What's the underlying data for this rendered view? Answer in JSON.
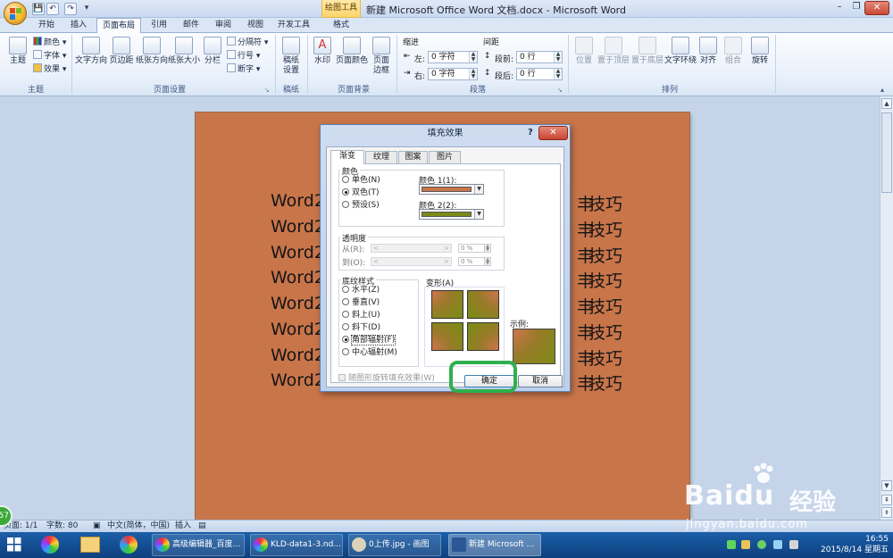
{
  "window": {
    "title": "新建 Microsoft Office Word 文档.docx - Microsoft Word",
    "contextual_tab_group": "绘图工具",
    "minimize": "–",
    "restore": "❐",
    "close": "✕"
  },
  "quick_access": {
    "save": "💾",
    "undo": "↶",
    "redo": "↷",
    "more": "▾"
  },
  "ribbon_tabs": [
    "开始",
    "插入",
    "页面布局",
    "引用",
    "邮件",
    "审阅",
    "视图",
    "开发工具",
    "格式"
  ],
  "ribbon_tabs_active": "页面布局",
  "ribbon": {
    "theme_group": {
      "label": "主题",
      "themes": "主题",
      "colors": "颜色",
      "fonts": "字体",
      "effects": "效果"
    },
    "page_setup_group": {
      "label": "页面设置",
      "text_direction": "文字方向",
      "margins": "页边距",
      "orientation": "纸张方向",
      "size": "纸张大小",
      "columns": "分栏",
      "breaks": "分隔符",
      "line_numbers": "行号",
      "hyphenation": "断字"
    },
    "draft_paper_group": {
      "label": "稿纸",
      "draft_setting_line1": "稿纸",
      "draft_setting_line2": "设置"
    },
    "page_background_group": {
      "label": "页面背景",
      "watermark": "水印",
      "page_color": "页面颜色",
      "page_borders_line1": "页面",
      "page_borders_line2": "边框"
    },
    "paragraph_group": {
      "label": "段落",
      "indent_label": "缩进",
      "indent_left_label": "左:",
      "indent_left_value": "0 字符",
      "indent_right_label": "右:",
      "indent_right_value": "0 字符",
      "spacing_label": "间距",
      "spacing_before_label": "段前:",
      "spacing_before_value": "0 行",
      "spacing_after_label": "段后:",
      "spacing_after_value": "0 行"
    },
    "arrange_group": {
      "label": "排列",
      "position": "位置",
      "bring_front": "置于顶层",
      "send_back": "置于底层",
      "text_wrap": "文字环绕",
      "align": "对齐",
      "group": "组合",
      "rotate": "旋转"
    }
  },
  "document": {
    "line_prefix": "Word2",
    "line_suffix": "技巧",
    "lines": 8
  },
  "dialog": {
    "title": "填充效果",
    "help": "?",
    "close": "✕",
    "tabs": [
      "渐变",
      "纹理",
      "图案",
      "图片"
    ],
    "active_tab": "渐变",
    "colors_section": {
      "label": "颜色",
      "one_color": "单色(N)",
      "two_colors": "双色(T)",
      "preset": "预设(S)",
      "selected": "双色(T)",
      "color1_label": "颜色 1(1):",
      "color1_hex": "#c8754a",
      "color2_label": "颜色 2(2):",
      "color2_hex": "#7e8a18"
    },
    "transparency_section": {
      "label": "透明度",
      "from_label": "从(R):",
      "from_value": "0 %",
      "to_label": "到(O):",
      "to_value": "0 %",
      "slider_left": "<",
      "slider_right": ">"
    },
    "shading_styles": {
      "label": "底纹样式",
      "options": [
        "水平(Z)",
        "垂直(V)",
        "斜上(U)",
        "斜下(D)",
        "角部辐射(F)",
        "中心辐射(M)"
      ],
      "selected": "角部辐射(F)"
    },
    "variants_label": "变形(A)",
    "sample_label": "示例:",
    "rotate_with_shape": "随图形旋转填充效果(W)",
    "ok": "确定",
    "cancel": "取消"
  },
  "status_bar": {
    "page": "页面: 1/1",
    "words": "字数: 80",
    "language": "中文(简体，中国)",
    "mode": "插入"
  },
  "taskbar": {
    "items": [
      "高级编辑器_百度...",
      "KLD-data1-3.nd...",
      "0上传.jpg - 画图",
      "新建 Microsoft ..."
    ],
    "active_item": "新建 Microsoft ...",
    "time": "16:55",
    "date": "2015/8/14 星期五"
  },
  "watermark": {
    "brand": "Baidu",
    "brand_cn": "经验",
    "url": "jingyan.baidu.com"
  },
  "left_badge": "57"
}
